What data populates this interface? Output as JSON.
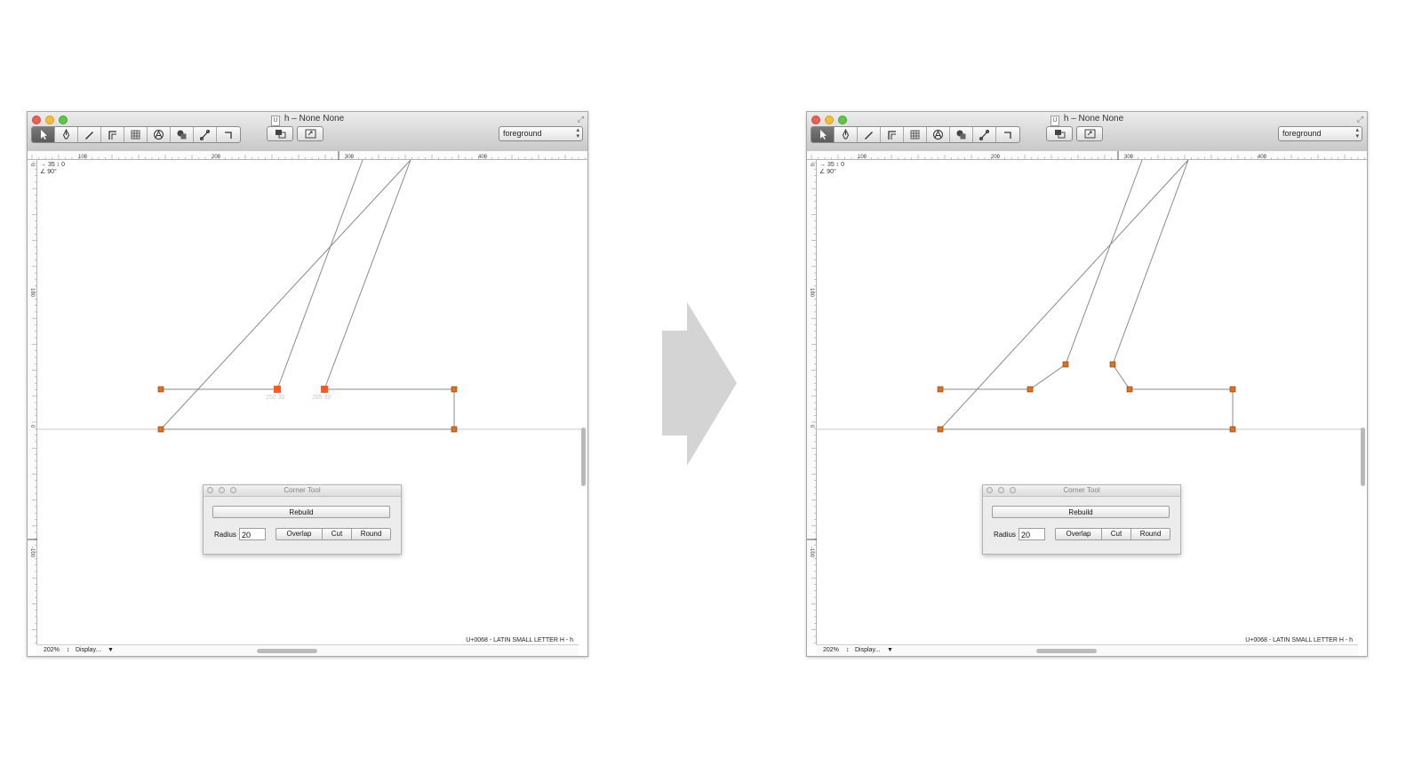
{
  "windows": [
    {
      "id": "before",
      "title": "h – None None",
      "doc_icon": "U",
      "toolbar": {
        "tools": [
          "pointer-icon",
          "pen-icon",
          "knife-icon",
          "corner-icon",
          "grid-icon",
          "component-icon",
          "shapes-icon",
          "measure-icon",
          "crop-icon"
        ],
        "selected_tool": 0,
        "view_buttons": [
          "preview-icon",
          "layers-icon"
        ],
        "layer_select": "foreground"
      },
      "ruler": {
        "top_labels": [
          "100",
          "200",
          "300",
          "400"
        ],
        "left_labels": [
          "0",
          "100",
          "0",
          "-100"
        ]
      },
      "info": {
        "line1": "→ 35 ↕ 0",
        "line2": "∠ 90°"
      },
      "point_labels": [
        "250 30",
        "285 30"
      ],
      "unicode_label": "U+0068 - LATIN SMALL LETTER H - h",
      "status": {
        "zoom": "202%",
        "display": "Display..."
      },
      "corner_tool": {
        "title": "Corner Tool",
        "rebuild_label": "Rebuild",
        "radius_label": "Radius",
        "radius_value": "20",
        "buttons": [
          "Overlap",
          "Cut",
          "Round"
        ]
      }
    },
    {
      "id": "after",
      "title": "h – None None",
      "doc_icon": "U",
      "toolbar": {
        "tools": [
          "pointer-icon",
          "pen-icon",
          "knife-icon",
          "corner-icon",
          "grid-icon",
          "component-icon",
          "shapes-icon",
          "measure-icon",
          "crop-icon"
        ],
        "selected_tool": 0,
        "view_buttons": [
          "preview-icon",
          "layers-icon"
        ],
        "layer_select": "foreground"
      },
      "ruler": {
        "top_labels": [
          "100",
          "200",
          "300",
          "400"
        ],
        "left_labels": [
          "0",
          "100",
          "0",
          "-100"
        ]
      },
      "info": {
        "line1": "→ 35 ↕ 0",
        "line2": "∠ 90°"
      },
      "point_labels": [],
      "unicode_label": "U+0068 - LATIN SMALL LETTER H - h",
      "status": {
        "zoom": "202%",
        "display": "Display..."
      },
      "corner_tool": {
        "title": "Corner Tool",
        "rebuild_label": "Rebuild",
        "radius_label": "Radius",
        "radius_value": "20",
        "buttons": [
          "Overlap",
          "Cut",
          "Round"
        ]
      }
    }
  ],
  "transition_arrow": "right-arrow-icon",
  "colors": {
    "selected_point": "#ff5a1f",
    "node": "#e0701a",
    "arrow": "#d4d4d4"
  }
}
